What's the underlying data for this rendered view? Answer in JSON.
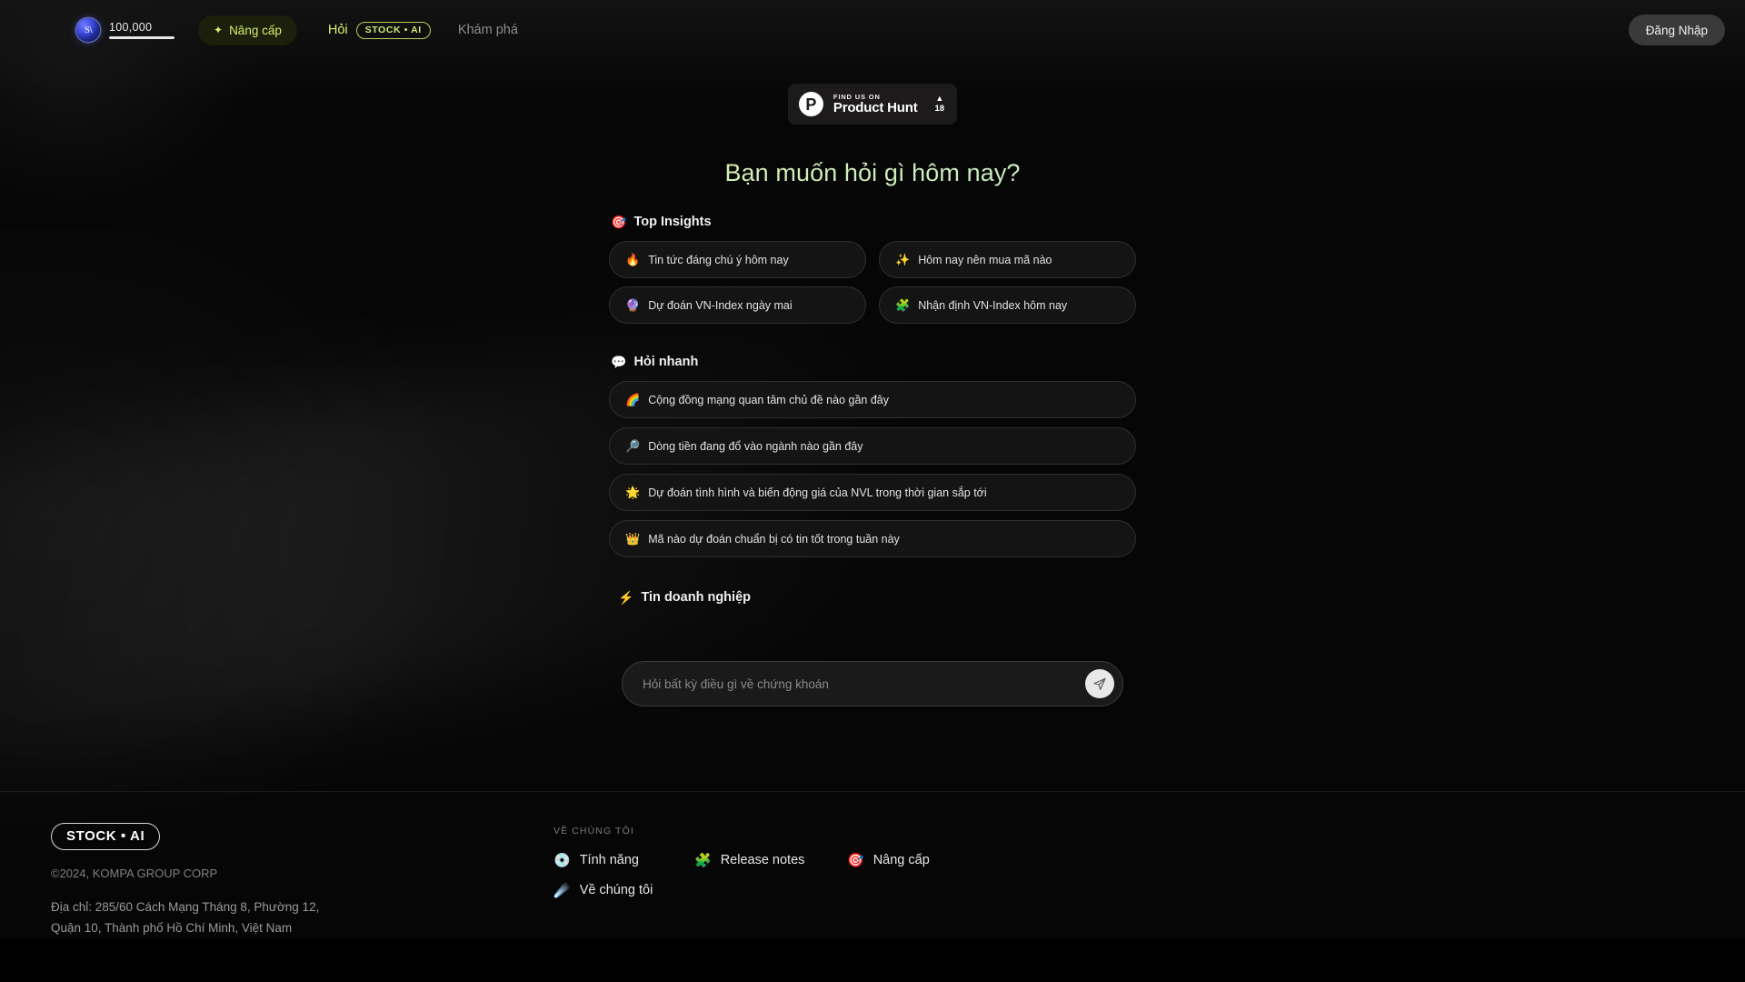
{
  "header": {
    "menu_icon": "hamburger-menu-icon",
    "credits": {
      "icon": "coin-icon",
      "coin_glyph": "S\\",
      "amount": "100,000"
    },
    "upgrade_button": {
      "icon": "sparkle-icon",
      "label": "Nâng cấp"
    },
    "nav": {
      "ask_label": "Hỏi",
      "ask_pill": "STOCK • AI",
      "explore_label": "Khám phá"
    },
    "login_button": "Đăng Nhập"
  },
  "product_hunt": {
    "logo_glyph": "P",
    "kicker": "FIND US ON",
    "name": "Product Hunt",
    "caret": "▲",
    "votes": "18"
  },
  "main": {
    "title": "Bạn muốn hỏi gì hôm nay?",
    "sections": {
      "top_insights": {
        "emoji": "🎯",
        "heading": "Top Insights",
        "items": [
          {
            "emoji": "🔥",
            "label": "Tin tức đáng chú ý hôm nay"
          },
          {
            "emoji": "✨",
            "label": "Hôm nay nên mua mã nào"
          },
          {
            "emoji": "🔮",
            "label": "Dự đoán VN-Index ngày mai"
          },
          {
            "emoji": "🧩",
            "label": "Nhận định VN-Index hôm nay"
          }
        ]
      },
      "quick_ask": {
        "emoji": "💬",
        "heading": "Hỏi nhanh",
        "items": [
          {
            "emoji": "🌈",
            "label": "Cộng đồng mạng quan tâm chủ đề nào gần đây"
          },
          {
            "emoji": "🔎",
            "label": "Dòng tiền đang đổ vào ngành nào gần đây"
          },
          {
            "emoji": "🌟",
            "label": "Dự đoán tình hình và biến động giá của NVL trong thời gian sắp tới"
          },
          {
            "emoji": "👑",
            "label": "Mã nào dự đoán chuẩn bị có tin tốt trong tuần này"
          }
        ]
      },
      "business_news": {
        "emoji": "⚡",
        "heading": "Tin doanh nghiệp",
        "items": []
      }
    },
    "composer": {
      "placeholder": "Hỏi bất kỳ điều gì về chứng khoán",
      "value": "",
      "send_icon": "send-paper-plane-icon"
    }
  },
  "footer": {
    "logo": "STOCK • AI",
    "copyright": "©2024, KOMPA GROUP CORP",
    "address": "Địa chỉ: 285/60 Cách Mạng Tháng 8, Phường 12, Quận 10, Thành phố Hồ Chí Minh, Việt Nam",
    "about_title": "VỀ CHÚNG TÔI",
    "links": [
      {
        "emoji": "💿",
        "label": "Tính năng"
      },
      {
        "emoji": "🧩",
        "label": "Release notes"
      },
      {
        "emoji": "🎯",
        "label": "Nâng cấp"
      },
      {
        "emoji": "☄️",
        "label": "Về chúng tôi"
      }
    ]
  },
  "colors": {
    "accent_green": "#d4f06a",
    "background": "#060606",
    "chip_bg": "#141414",
    "chip_border": "#2e2e2e"
  }
}
